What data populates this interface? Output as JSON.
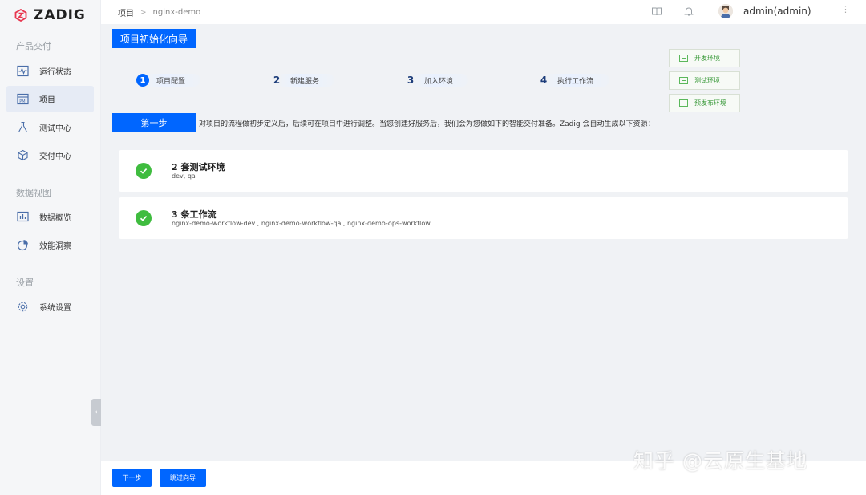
{
  "app": {
    "brand": "ZADIG"
  },
  "sidebar": {
    "sections": [
      {
        "title": "产品交付"
      },
      {
        "title": "数据视图"
      },
      {
        "title": "设置"
      }
    ],
    "items": [
      {
        "label": "运行状态",
        "icon": "activity-icon"
      },
      {
        "label": "项目",
        "icon": "project-icon",
        "active": true
      },
      {
        "label": "测试中心",
        "icon": "flask-icon"
      },
      {
        "label": "交付中心",
        "icon": "cube-icon"
      },
      {
        "label": "数据概览",
        "icon": "bar-chart-icon"
      },
      {
        "label": "效能洞察",
        "icon": "pie-chart-icon"
      },
      {
        "label": "系统设置",
        "icon": "gear-icon"
      }
    ]
  },
  "header": {
    "breadcrumb": [
      "项目",
      "nginx-demo"
    ],
    "user": "admin(admin)"
  },
  "wizard": {
    "title": "项目初始化向导",
    "steps": [
      {
        "num": "1",
        "label": "项目配置",
        "active": true
      },
      {
        "num": "2",
        "label": "新建服务"
      },
      {
        "num": "3",
        "label": "加入环境"
      },
      {
        "num": "4",
        "label": "执行工作流"
      }
    ],
    "env_buttons": [
      "开发环境",
      "测试环境",
      "预发布环境"
    ],
    "step_tag": "第一步",
    "intro": "对项目的流程做初步定义后，后续可在项目中进行调整。当您创建好服务后，我们会为您做如下的智能交付准备。Zadig 会自动生成以下资源："
  },
  "cards": [
    {
      "title": "2 套测试环境",
      "sub": "dev, qa"
    },
    {
      "title": "3 条工作流",
      "sub": "nginx-demo-workflow-dev , nginx-demo-workflow-qa , nginx-demo-ops-workflow"
    }
  ],
  "footer": {
    "next": "下一步",
    "skip": "跳过向导"
  },
  "watermark": "知乎 @云原生基地",
  "colors": {
    "primary": "#0066ff",
    "success": "#3fbc3f",
    "brand": "#e8364f"
  }
}
